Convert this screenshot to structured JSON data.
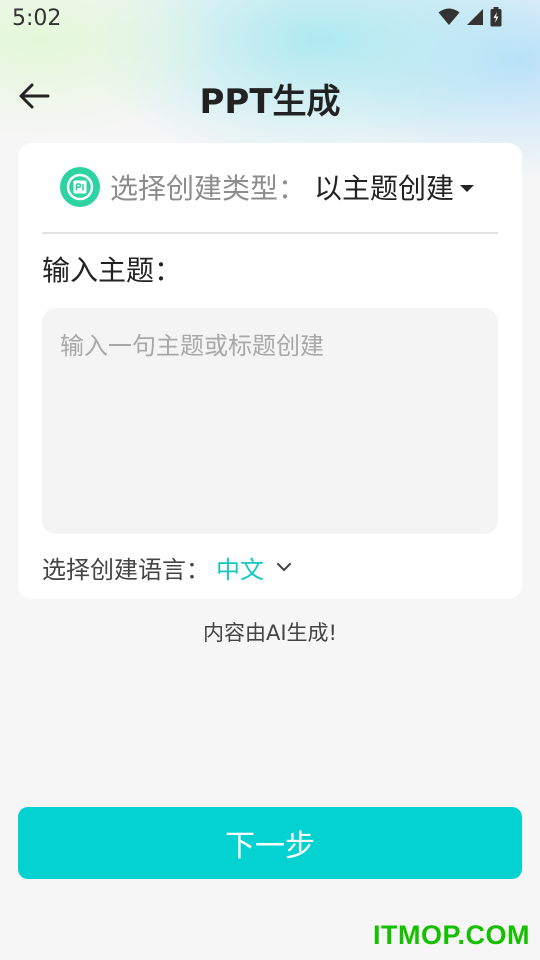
{
  "status_bar": {
    "time": "5:02",
    "icons": [
      "wifi-icon",
      "cell-signal-icon",
      "battery-charging-icon"
    ]
  },
  "header": {
    "back_icon": "arrow-left-icon",
    "title": "PPT生成"
  },
  "create_type": {
    "icon": "ppt-icon",
    "label": "选择创建类型：",
    "value": "以主题创建"
  },
  "topic": {
    "label": "输入主题：",
    "value": "",
    "placeholder": "输入一句主题或标题创建"
  },
  "language": {
    "label": "选择创建语言：",
    "value": "中文"
  },
  "note": "内容由AI生成!",
  "next_button": "下一步",
  "watermark": "ITMOP.COM",
  "colors": {
    "accent": "#03d2d0",
    "accent_text": "#13c9c6",
    "icon_green": "#2ed3a3",
    "watermark": "#15c000"
  }
}
